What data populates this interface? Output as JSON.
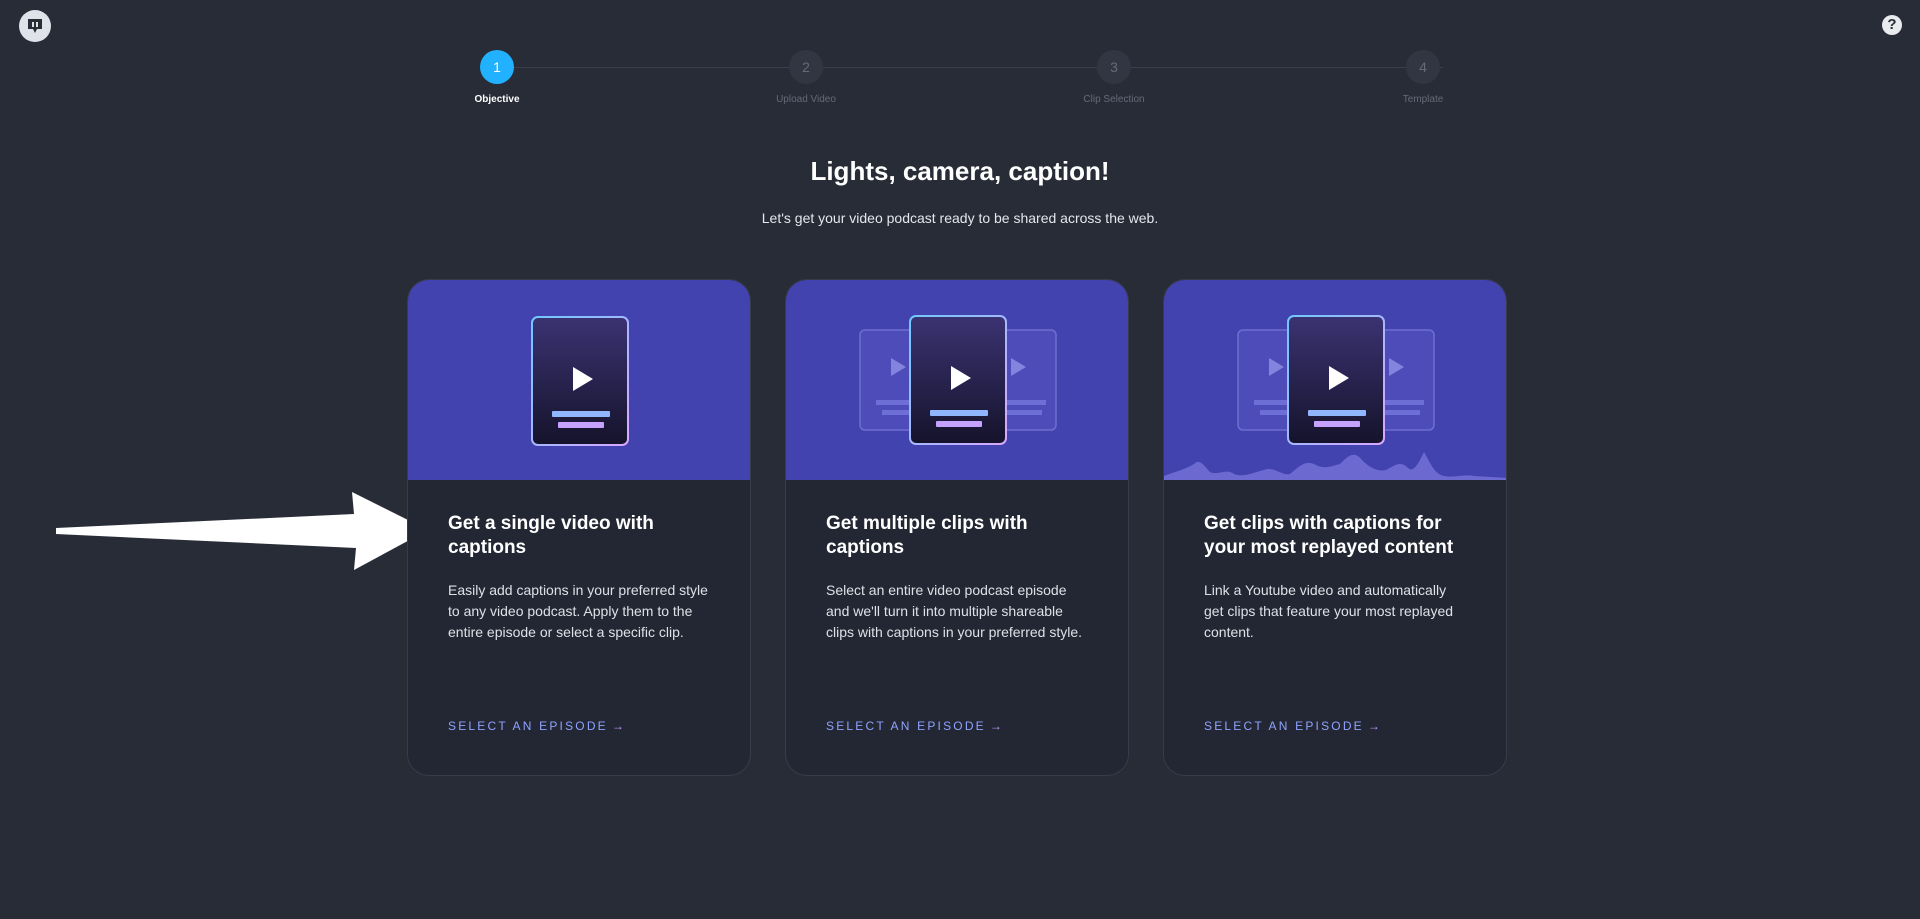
{
  "header": {
    "logo_icon": "headliner-logo-icon",
    "help_glyph": "?"
  },
  "stepper": {
    "steps": [
      {
        "number": "1",
        "label": "Objective",
        "active": true
      },
      {
        "number": "2",
        "label": "Upload Video",
        "active": false
      },
      {
        "number": "3",
        "label": "Clip Selection",
        "active": false
      },
      {
        "number": "4",
        "label": "Template",
        "active": false
      }
    ]
  },
  "main": {
    "title": "Lights, camera, caption!",
    "subtitle": "Let's get your video podcast ready to be shared across the web."
  },
  "cards": [
    {
      "heading": "Get a single video with captions",
      "description": "Easily add captions in your preferred style to any video podcast. Apply them to the entire episode or select a specific clip.",
      "cta": "SELECT AN EPISODE",
      "cta_arrow": "→"
    },
    {
      "heading": "Get multiple clips with captions",
      "description": "Select an entire video podcast episode and we'll turn it into multiple shareable clips with captions in your preferred style.",
      "cta": "SELECT AN EPISODE",
      "cta_arrow": "→"
    },
    {
      "heading": "Get clips with captions for your most replayed content",
      "description": "Link a Youtube video and automatically get clips that feature your most replayed content.",
      "cta": "SELECT AN EPISODE",
      "cta_arrow": "→"
    }
  ],
  "colors": {
    "background": "#282c36",
    "accent": "#21b1ff",
    "banner": "#4343b0",
    "cta": "#8fa3ff"
  }
}
